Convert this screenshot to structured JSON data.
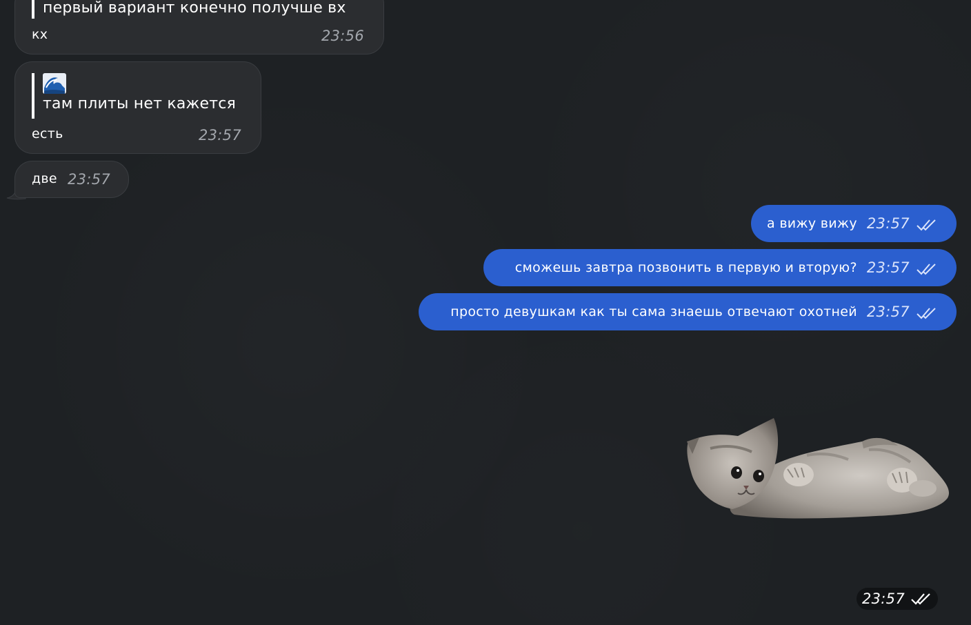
{
  "colors": {
    "background": "#1e2124",
    "incoming_bubble": "#2b2d30",
    "outgoing_bubble": "#2b5fcf",
    "timestamp_in": "#a3a7ad"
  },
  "messages_in": [
    {
      "quote": "первый вариант конечно получше вх",
      "text": "кх",
      "time": "23:56"
    },
    {
      "quote_icon": "wave-emoji",
      "quote": "там плиты нет кажется",
      "text": "есть",
      "time": "23:57"
    },
    {
      "text": "две",
      "time": "23:57"
    }
  ],
  "messages_out": [
    {
      "text": "а вижу вижу",
      "time": "23:57",
      "status": "read-double-check-icon"
    },
    {
      "text": "сможешь завтра позвонить в первую и вторую?",
      "time": "23:57",
      "status": "read-double-check-icon"
    },
    {
      "text": "просто девушкам как ты сама знаешь отвечают охотней",
      "time": "23:57",
      "status": "read-double-check-icon"
    }
  ],
  "sticker": {
    "icon": "kitten-sticker",
    "time": "23:57",
    "status": "read-double-check-icon"
  }
}
